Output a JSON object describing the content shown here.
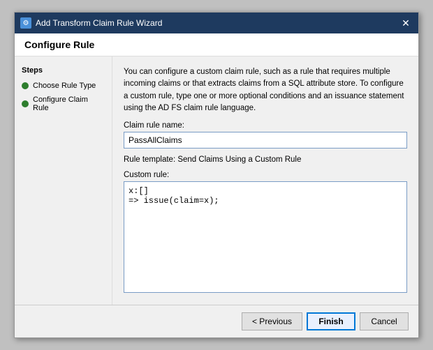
{
  "window": {
    "title": "Add Transform Claim Rule Wizard",
    "close_label": "✕"
  },
  "page": {
    "title": "Configure Rule"
  },
  "steps": {
    "heading": "Steps",
    "items": [
      {
        "label": "Choose Rule Type"
      },
      {
        "label": "Configure Claim Rule"
      }
    ]
  },
  "main": {
    "description": "You can configure a custom claim rule, such as a rule that requires multiple incoming claims or that extracts claims from a SQL attribute store. To configure a custom rule, type one or more optional conditions and an issuance statement using the AD FS claim rule language.",
    "claim_rule_name_label": "Claim rule name:",
    "claim_rule_name_value": "PassAllClaims",
    "rule_template_label": "Rule template: Send Claims Using a Custom Rule",
    "custom_rule_label": "Custom rule:",
    "custom_rule_value": "x:[]\n=> issue(claim=x);"
  },
  "footer": {
    "previous_label": "< Previous",
    "finish_label": "Finish",
    "cancel_label": "Cancel"
  }
}
